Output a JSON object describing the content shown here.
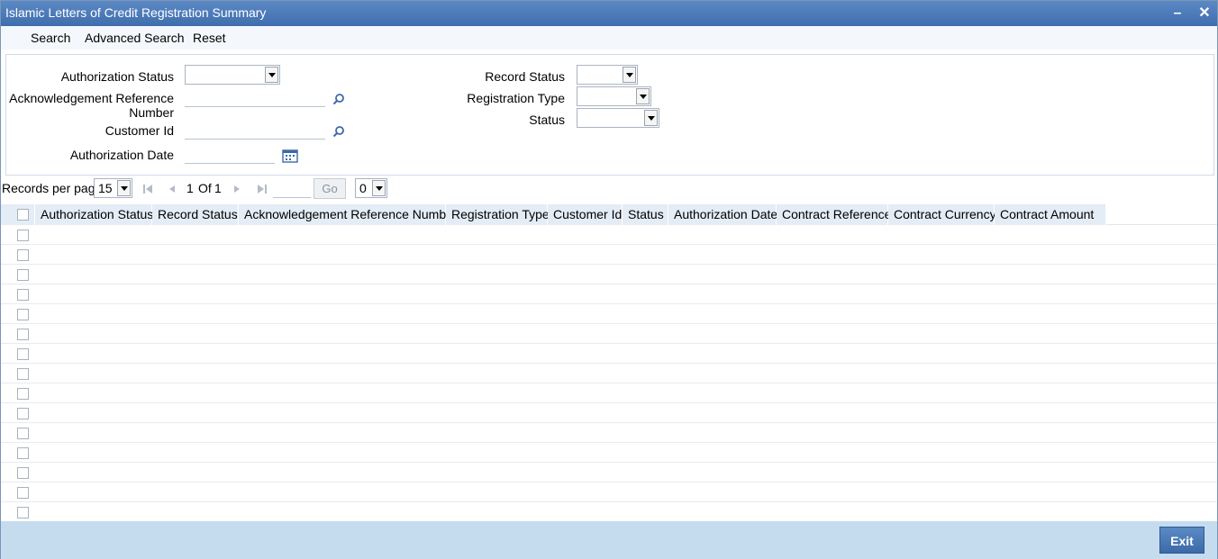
{
  "window": {
    "title": "Islamic Letters of Credit Registration Summary",
    "minimize_icon": "minimize-icon",
    "close_icon": "close-icon"
  },
  "menu": {
    "search": "Search",
    "advanced_search": "Advanced Search",
    "reset": "Reset"
  },
  "criteria": {
    "authorization_status": "Authorization Status",
    "ack_ref_line1": "Acknowledgement Reference",
    "ack_ref_line2": "Number",
    "customer_id": "Customer Id",
    "authorization_date": "Authorization Date",
    "record_status": "Record Status",
    "registration_type": "Registration Type",
    "status": "Status"
  },
  "pager": {
    "records_per_page_label": "Records per page",
    "records_per_page_value": "15",
    "page_current": "1",
    "page_of": "Of",
    "page_total": "1",
    "go_label": "Go",
    "extra_select_value": "0"
  },
  "grid": {
    "columns": [
      "Authorization Status",
      "Record Status",
      "Acknowledgement Reference Number",
      "Registration Type",
      "Customer Id",
      "Status",
      "Authorization Date",
      "Contract Reference",
      "Contract Currency",
      "Contract Amount"
    ],
    "row_count": 15
  },
  "footer": {
    "exit_label": "Exit"
  },
  "colors": {
    "title_bar": "#4a78b8",
    "footer": "#c5dcef",
    "header_cell": "#e4ecf5"
  }
}
